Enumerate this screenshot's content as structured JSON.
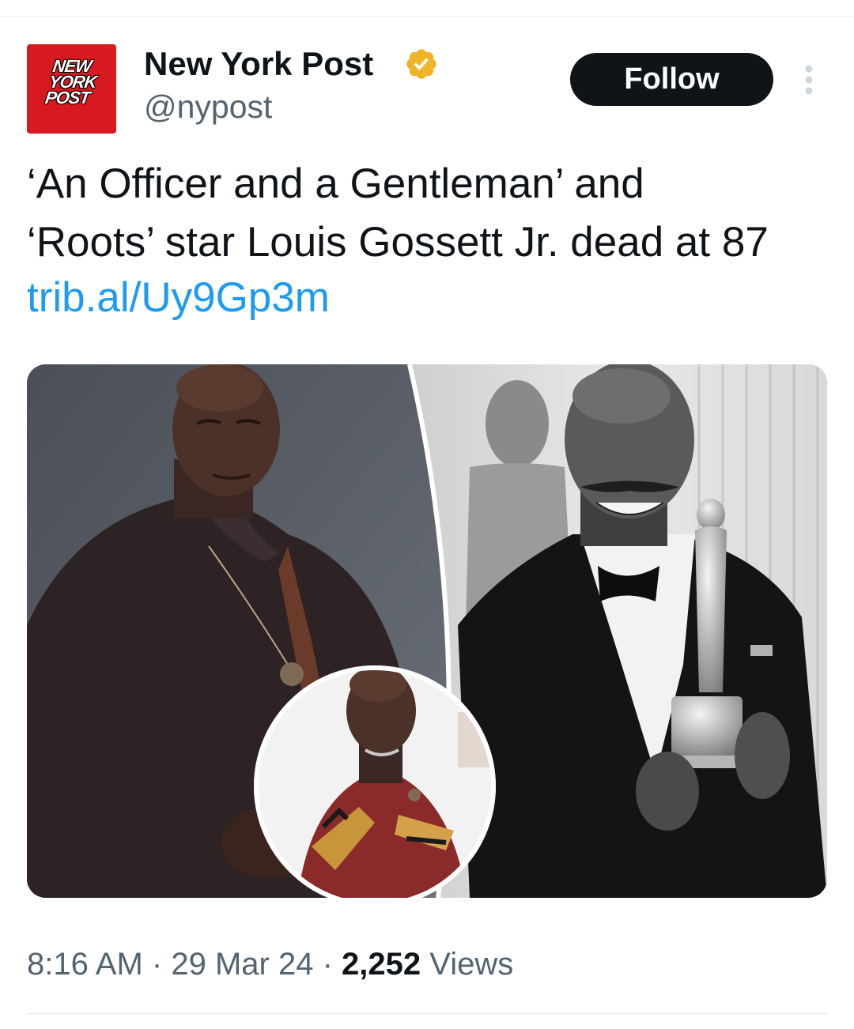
{
  "account": {
    "display_name": "New York Post",
    "handle": "@nypost",
    "avatar_logo_lines": [
      "NEW",
      "YORK",
      "POST"
    ],
    "verified": true,
    "verified_color": "#f0b429"
  },
  "actions": {
    "follow_label": "Follow",
    "more_icon": "more-vertical-icon"
  },
  "tweet": {
    "text_lines": [
      "‘An Officer and a Gentleman’ and",
      "‘Roots’ star Louis Gossett Jr. dead at 87"
    ],
    "link": "trib.al/Uy9Gp3m"
  },
  "media": {
    "description_icon": "photo-collage"
  },
  "meta": {
    "time": "8:16 AM",
    "separator": "·",
    "date": "29 Mar 24",
    "views_count": "2,252",
    "views_label": "Views"
  },
  "colors": {
    "brand_red": "#d71920",
    "link_blue": "#1d9bf0",
    "button_black": "#0f1419",
    "secondary_text": "#536471"
  }
}
